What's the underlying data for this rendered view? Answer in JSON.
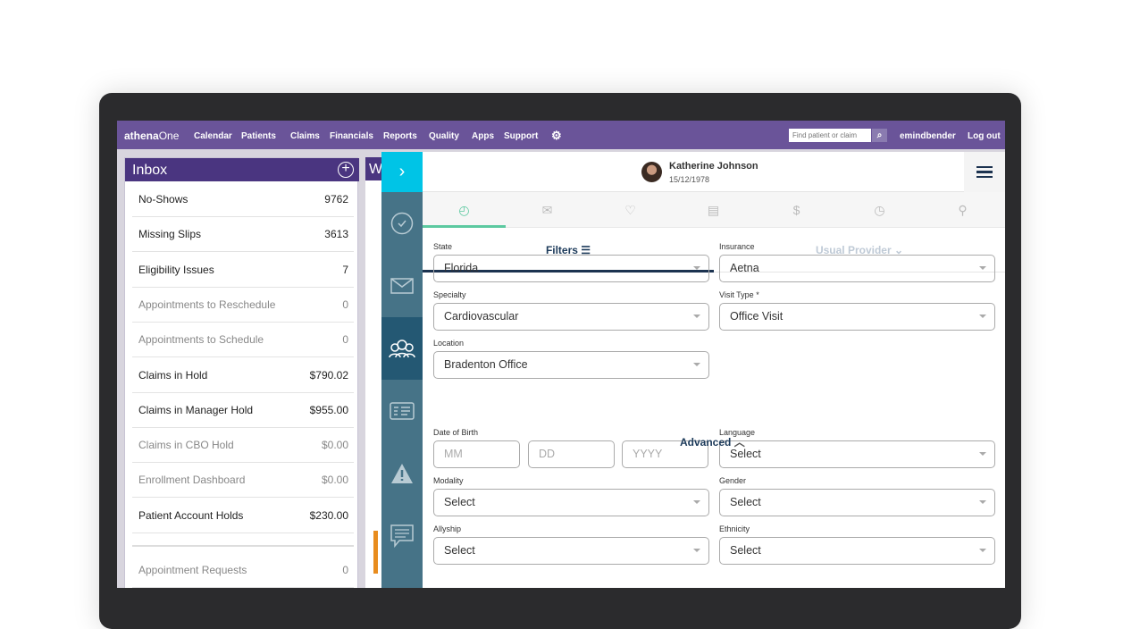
{
  "nav": {
    "logo": "athena",
    "logo2": "One",
    "items": [
      "Calendar",
      "Patients",
      "Claims",
      "Financials",
      "Reports",
      "Quality",
      "Apps",
      "Support"
    ],
    "settings_icon": "gear-icon",
    "search_placeholder": "Find patient or claim",
    "user": "emindbender",
    "logout": "Log out"
  },
  "inbox": {
    "title": "Inbox",
    "rows": [
      {
        "label": "No-Shows",
        "value": "9762",
        "muted": false
      },
      {
        "label": "Missing Slips",
        "value": "3613",
        "muted": false
      },
      {
        "label": "Eligibility Issues",
        "value": "7",
        "muted": false
      },
      {
        "label": "Appointments to Reschedule",
        "value": "0",
        "muted": true
      },
      {
        "label": "Appointments to Schedule",
        "value": "0",
        "muted": true
      },
      {
        "label": "Claims in Hold",
        "value": "$790.02",
        "muted": false
      },
      {
        "label": "Claims in Manager Hold",
        "value": "$955.00",
        "muted": false
      },
      {
        "label": "Claims in CBO Hold",
        "value": "$0.00",
        "muted": true
      },
      {
        "label": "Enrollment Dashboard",
        "value": "$0.00",
        "muted": true
      },
      {
        "label": "Patient Account Holds",
        "value": "$230.00",
        "muted": false
      }
    ],
    "extra": {
      "label": "Appointment Requests",
      "value": "0"
    }
  },
  "panel2": {
    "title": "W"
  },
  "patient": {
    "name": "Katherine Johnson",
    "dob": "15/12/1978"
  },
  "tabs": [
    "check-circle-icon",
    "mail-icon",
    "heart-icon",
    "document-icon",
    "dollar-tag-icon",
    "stopwatch-icon",
    "location-pin-icon"
  ],
  "filters": {
    "filters_label": "Filters",
    "usual_provider": "Usual Provider",
    "advanced": "Advanced"
  },
  "form": {
    "state": {
      "label": "State",
      "value": "Florida"
    },
    "insurance": {
      "label": "Insurance",
      "value": "Aetna"
    },
    "specialty": {
      "label": "Specialty",
      "value": "Cardiovascular"
    },
    "visit_type": {
      "label": "Visit Type *",
      "value": "Office Visit"
    },
    "location": {
      "label": "Location",
      "value": "Bradenton Office"
    },
    "dob": {
      "label": "Date of Birth",
      "mm": "MM",
      "dd": "DD",
      "yyyy": "YYYY"
    },
    "language": {
      "label": "Language",
      "value": "Select"
    },
    "modality": {
      "label": "Modality",
      "value": "Select"
    },
    "gender": {
      "label": "Gender",
      "value": "Select"
    },
    "allyship": {
      "label": "Allyship",
      "value": "Select"
    },
    "ethnicity": {
      "label": "Ethnicity",
      "value": "Select"
    }
  },
  "colors": {
    "nav": "#6a5499",
    "inbox_header": "#4a3580",
    "rail": "#467387",
    "rail_toggle": "#00c4e6",
    "active_tab": "#5cc9a0",
    "navy": "#1c3350"
  }
}
